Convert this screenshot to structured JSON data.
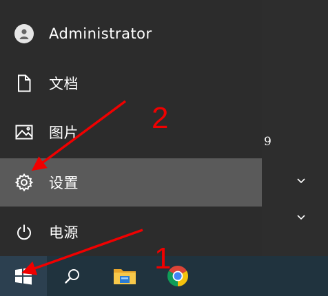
{
  "menu": {
    "user": {
      "label": "Administrator",
      "icon": "user-avatar-icon"
    },
    "items": [
      {
        "label": "文档",
        "icon": "document-icon"
      },
      {
        "label": "图片",
        "icon": "picture-icon"
      },
      {
        "label": "设置",
        "icon": "gear-icon",
        "active": true
      },
      {
        "label": "电源",
        "icon": "power-icon"
      }
    ]
  },
  "right_pane": {
    "number": "9"
  },
  "taskbar": {
    "items": [
      {
        "icon": "windows-logo-icon"
      },
      {
        "icon": "search-icon"
      },
      {
        "icon": "file-explorer-icon"
      },
      {
        "icon": "chrome-icon"
      }
    ]
  },
  "annotations": {
    "label_1": "1",
    "label_2": "2",
    "color": "#f00000"
  }
}
